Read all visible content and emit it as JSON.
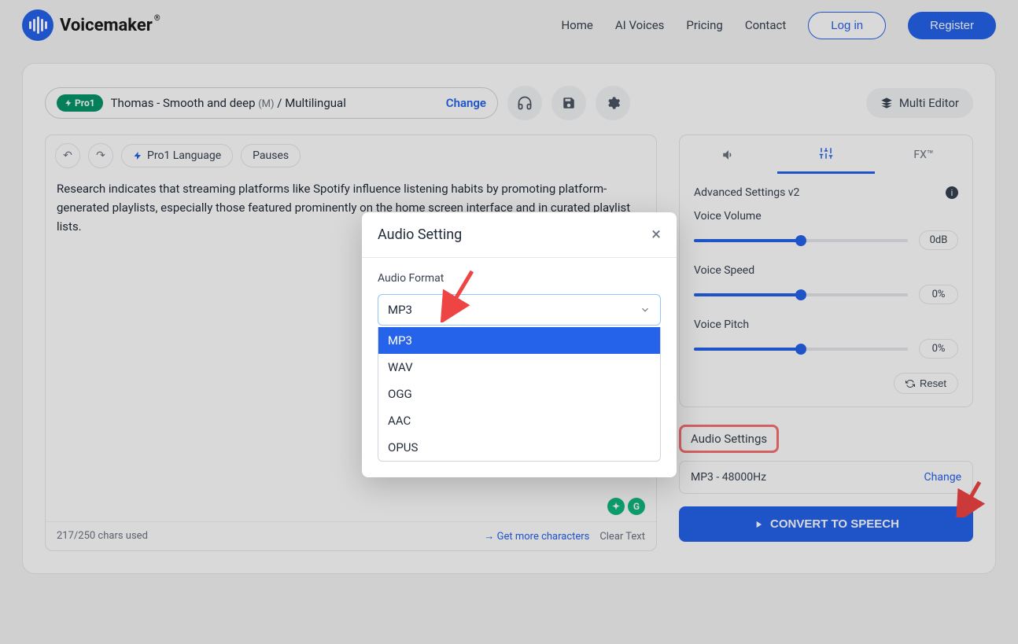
{
  "brand": {
    "name": "Voicemaker"
  },
  "nav": {
    "home": "Home",
    "ai_voices": "AI Voices",
    "pricing": "Pricing",
    "contact": "Contact",
    "login": "Log in",
    "register": "Register"
  },
  "voice": {
    "badge": "Pro1",
    "name": "Thomas - Smooth and deep",
    "gender": "(M)",
    "lang": " / Multilingual",
    "change": "Change"
  },
  "multi_editor": "Multi Editor",
  "editor": {
    "pro_lang": "Pro1 Language",
    "pauses": "Pauses",
    "text": "Research indicates that streaming platforms like Spotify influence listening habits by promoting platform-generated playlists, especially those featured prominently on the home screen interface and in curated playlist lists.",
    "chars": "217/250 chars used",
    "get_more": "Get more characters",
    "clear": "Clear Text"
  },
  "side": {
    "fx": "FX™",
    "adv": "Advanced Settings v2",
    "vol_label": "Voice Volume",
    "vol_val": "0dB",
    "speed_label": "Voice Speed",
    "speed_val": "0%",
    "pitch_label": "Voice Pitch",
    "pitch_val": "0%",
    "reset": "Reset",
    "audio_settings": "Audio Settings",
    "current": "MP3 - 48000Hz",
    "change": "Change",
    "convert": "CONVERT TO SPEECH"
  },
  "modal": {
    "title": "Audio Setting",
    "label": "Audio Format",
    "selected": "MP3",
    "options": [
      "MP3",
      "WAV",
      "OGG",
      "AAC",
      "OPUS"
    ]
  }
}
